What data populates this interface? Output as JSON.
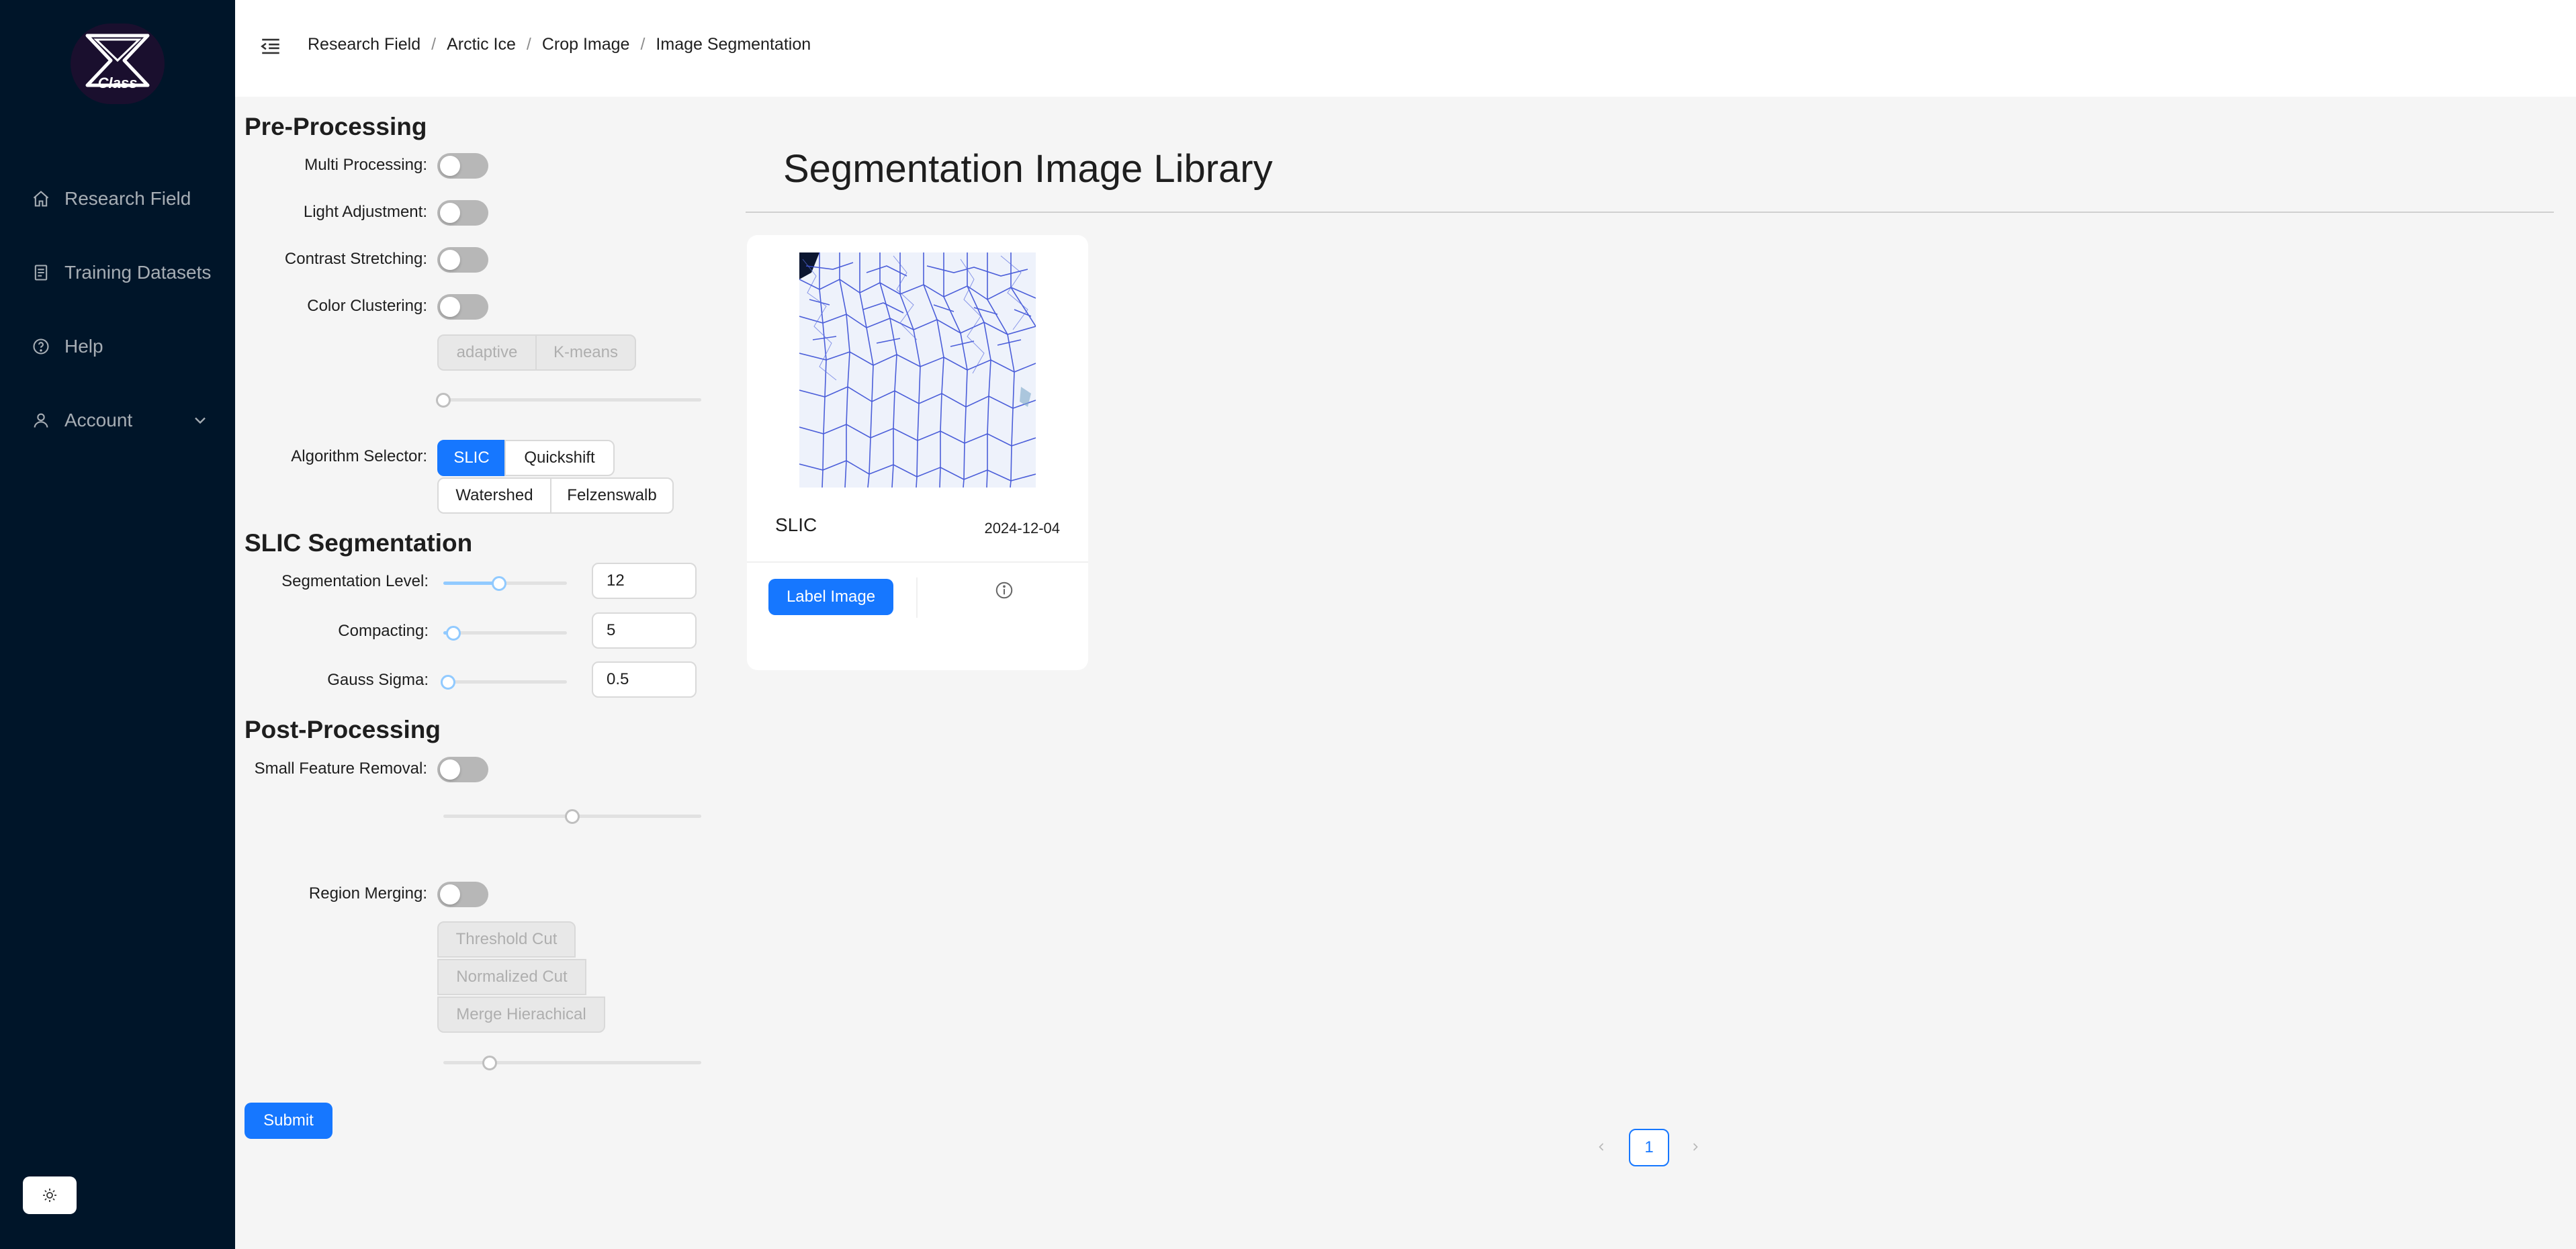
{
  "app": {
    "logo_text": "Class"
  },
  "sidebar": {
    "items": [
      {
        "label": "Research Field",
        "icon": "home-icon"
      },
      {
        "label": "Training Datasets",
        "icon": "file-text-icon"
      },
      {
        "label": "Help",
        "icon": "question-circle-icon"
      },
      {
        "label": "Account",
        "icon": "user-icon"
      }
    ],
    "theme_toggle_icon": "sun-icon"
  },
  "header": {
    "breadcrumb": [
      "Research Field",
      "Arctic Ice",
      "Crop Image",
      "Image Segmentation"
    ],
    "separator": "/"
  },
  "preprocessing": {
    "title": "Pre-Processing",
    "multi_processing_label": "Multi Processing",
    "light_adjustment_label": "Light Adjustment",
    "contrast_stretching_label": "Contrast Stretching",
    "color_clustering_label": "Color Clustering",
    "clustering_options": [
      "adaptive",
      "K-means"
    ],
    "clustering_slider_value": 0,
    "algorithm_label": "Algorithm Selector",
    "algorithms": [
      "SLIC",
      "Quickshift",
      "Watershed",
      "Felzenswalb"
    ],
    "selected_algorithm": "SLIC"
  },
  "slic": {
    "title": "SLIC Segmentation",
    "segmentation_level_label": "Segmentation Level",
    "segmentation_level_value": "12",
    "segmentation_level_fraction": 0.45,
    "compacting_label": "Compacting",
    "compacting_value": "5",
    "compacting_fraction": 0.08,
    "gauss_sigma_label": "Gauss Sigma",
    "gauss_sigma_value": "0.5",
    "gauss_sigma_fraction": 0.04
  },
  "postprocessing": {
    "title": "Post-Processing",
    "small_feature_label": "Small Feature Removal",
    "small_feature_slider_fraction": 0.5,
    "region_merging_label": "Region Merging",
    "merging_options": [
      "Threshold Cut",
      "Normalized Cut",
      "Merge Hierachical"
    ],
    "merging_slider_fraction": 0.18
  },
  "submit_label": "Submit",
  "library": {
    "title": "Segmentation Image Library",
    "cards": [
      {
        "title": "SLIC",
        "date": "2024-12-04",
        "button_label": "Label Image",
        "info_icon": "info-circle-icon"
      }
    ]
  },
  "pagination": {
    "current_page": "1",
    "prev_icon": "left-icon",
    "next_icon": "right-icon"
  },
  "colors": {
    "sidebar_bg": "#001529",
    "primary": "#1677ff",
    "page_bg": "#f5f5f5"
  }
}
